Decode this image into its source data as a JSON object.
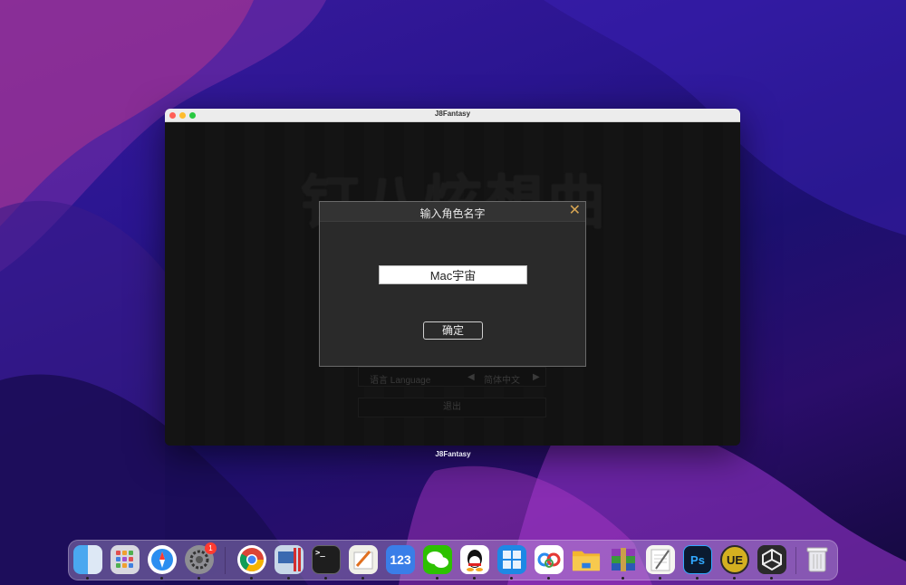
{
  "window": {
    "title": "J8Fantasy",
    "caption": "J8Fantasy"
  },
  "game": {
    "logo_text": "钉八炫想曲",
    "language_label": "语言 Language",
    "language_value": "简体中文",
    "exit_label": "退出"
  },
  "dialog": {
    "title": "输入角色名字",
    "close_glyph": "✕",
    "name_value": "Mac宇宙",
    "confirm_label": "确定"
  },
  "dock": {
    "items": [
      {
        "name": "finder",
        "badge": ""
      },
      {
        "name": "launchpad",
        "badge": ""
      },
      {
        "name": "safari",
        "badge": ""
      },
      {
        "name": "system-preferences",
        "badge": "1"
      },
      {
        "name": "chrome",
        "badge": ""
      },
      {
        "name": "parallels",
        "badge": ""
      },
      {
        "name": "terminal",
        "badge": ""
      },
      {
        "name": "pages",
        "badge": ""
      },
      {
        "name": "123-app",
        "badge": "",
        "label": "123"
      },
      {
        "name": "wechat",
        "badge": ""
      },
      {
        "name": "qq",
        "badge": ""
      },
      {
        "name": "windows-app",
        "badge": ""
      },
      {
        "name": "baidu-netdisk",
        "badge": ""
      },
      {
        "name": "folder",
        "badge": ""
      },
      {
        "name": "winrar",
        "badge": ""
      },
      {
        "name": "textedit",
        "badge": ""
      },
      {
        "name": "photoshop",
        "badge": "",
        "label": "Ps"
      },
      {
        "name": "ultraedit",
        "badge": "",
        "label": "UE"
      },
      {
        "name": "unity",
        "badge": ""
      },
      {
        "name": "trash",
        "badge": ""
      }
    ]
  },
  "colors": {
    "accent_close": "#d7a552",
    "dialog_bg": "#2a2a2a"
  }
}
